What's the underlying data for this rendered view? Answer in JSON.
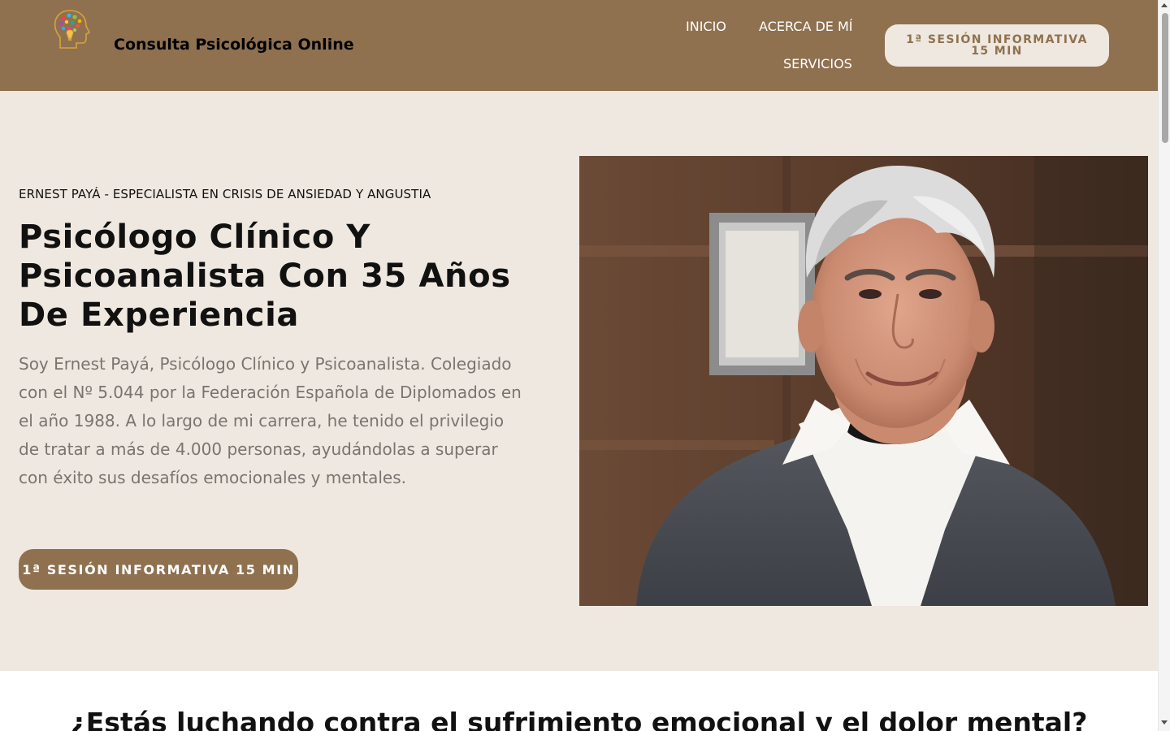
{
  "header": {
    "brand": "Consulta Psicológica Online",
    "logo_icon": "brain-head-logo-icon",
    "nav": {
      "inicio": "INICIO",
      "acerca": "ACERCA DE MÍ",
      "servicios": "SERVICIOS"
    },
    "cta_label": "1ª SESIÓN INFORMATIVA 15 MIN"
  },
  "hero": {
    "eyebrow": "ERNEST PAYÁ - ESPECIALISTA EN CRISIS DE ANSIEDAD Y ANGUSTIA",
    "title": "Psicólogo Clínico Y Psicoanalista Con 35 Años De Experiencia",
    "description": "Soy Ernest Payá, Psicólogo Clínico y Psicoanalista. Colegiado con el Nº 5.044 por la Federación Española de Diplomados en el año 1988. A lo largo de mi carrera, he tenido el privilegio de tratar a más de 4.000 personas, ayudándolas a superar con éxito sus desafíos emocionales y mentales.",
    "cta_label": "1ª SESIÓN INFORMATIVA 15 MIN"
  },
  "next_section": {
    "title": "¿Estás luchando contra el sufrimiento emocional y el dolor mental?"
  },
  "colors": {
    "brand_brown": "#8f7150",
    "hero_background": "#efe8e0",
    "text_dark": "#111111",
    "text_muted": "#7a7470"
  }
}
